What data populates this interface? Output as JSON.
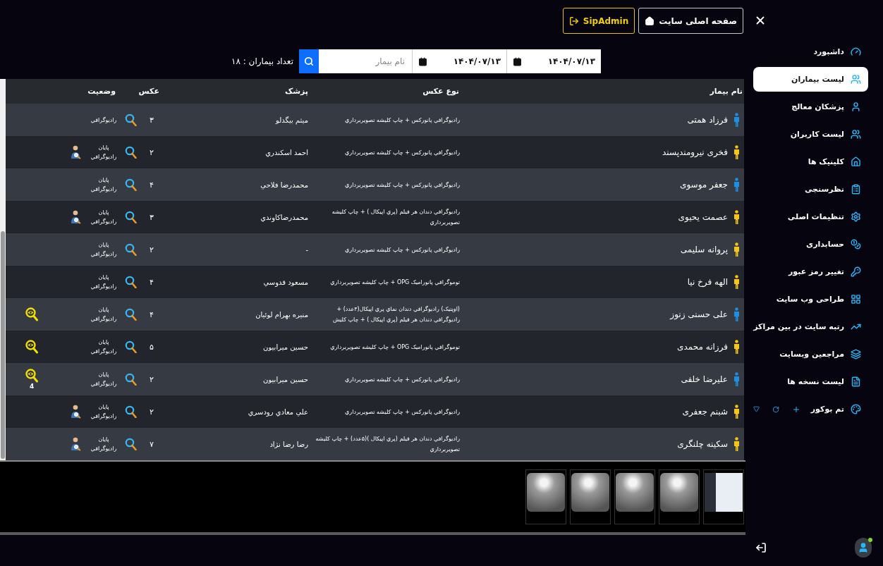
{
  "topbar": {
    "buttons": [
      {
        "label": "صفحه اصلی سایت",
        "kind": "home"
      },
      {
        "label": "SipAdmin",
        "kind": "admin"
      }
    ]
  },
  "filters": {
    "date_from": "۱۴۰۴/۰۷/۱۳",
    "date_to": "۱۴۰۴/۰۷/۱۳",
    "search": {
      "placeholder": "نام بیمار"
    },
    "count": "تعداد بیماران : ۱۸"
  },
  "table": {
    "columns": [
      "نام بیمار",
      "نوع عکس",
      "پزشک",
      "عکس",
      "وضعیت"
    ],
    "rows": [
      {
        "name": "فرزاد همتی",
        "color": "#1e8fe0",
        "type": "رادیوگرافي پانورکس + چاپ کلیشه تصویربرداري",
        "doctor": "میثم بیگدلو",
        "count": "۳",
        "status": "رادیوگرافي"
      },
      {
        "name": "فخری نیرومندپسند",
        "color": "#f5c518",
        "type": "رادیوگرافي پانورکس + چاپ کلیشه تصویربرداري",
        "doctor": "احمد اسکندري",
        "count": "۲",
        "status": "پایان رادیوگرافي",
        "marker": {
          "kind": "reporter"
        }
      },
      {
        "name": "جعفر موسوی",
        "color": "#1e8fe0",
        "type": "رادیوگرافي پانورکس + چاپ کلیشه تصویربرداري",
        "doctor": "محمدرضا فلاحي",
        "count": "۴",
        "status": "پایان رادیوگرافي"
      },
      {
        "name": "عصمت یحیوی",
        "color": "#f5c518",
        "type": "رادیوگرافي دندان هر فیلم (پري اپیکال ) + چاپ کلیشه تصویربرداري",
        "doctor": "محمدرضاکاوندي",
        "count": "۳",
        "status": "پایان رادیوگرافي",
        "marker": {
          "kind": "reporter"
        }
      },
      {
        "name": "پروانه سلیمی",
        "color": "#f5c518",
        "type": "رادیوگرافي پانورکس + چاپ کلیشه تصویربرداري",
        "doctor": "-",
        "count": "۲",
        "status": "پایان رادیوگرافي"
      },
      {
        "name": "الهه فرخ نیا",
        "color": "#f5c518",
        "type": "توموگرافي پانورامیک OPG + چاپ کلیشه تصویربرداري",
        "doctor": "مسعود قدوسي",
        "count": "۴",
        "status": "پایان رادیوگرافي"
      },
      {
        "name": "علی حسنی زنوز",
        "color": "#1e8fe0",
        "type": "(اوپتیک) رادیوگرافي دندان نماي پري اپیکال(۳عدد) + رادیوگرافي دندان هر فیلم (پري اپیکال ) + چاپ کلیش",
        "doctor": "منیره بهرام لوئیان",
        "count": "۴",
        "status": "پایان رادیوگرافي",
        "marker": {
          "kind": "review"
        }
      },
      {
        "name": "فرزانه محمدی",
        "color": "#f5c518",
        "type": "توموگرافي پانورامیک OPG + چاپ کلیشه تصویربرداري",
        "doctor": "حسین میرابیون",
        "count": "۵",
        "status": "پایان رادیوگرافي",
        "marker": {
          "kind": "review"
        }
      },
      {
        "name": "علیرضا خلفی",
        "color": "#1e8fe0",
        "type": "رادیوگرافي پانورکس + چاپ کلیشه تصویربرداري",
        "doctor": "حسین میرابیون",
        "count": "۲",
        "status": "پایان رادیوگرافي",
        "marker": {
          "kind": "review",
          "count": "4"
        }
      },
      {
        "name": "شبنم جعفری",
        "color": "#f5c518",
        "type": "رادیوگرافي پانورکس + چاپ کلیشه تصویربرداري",
        "doctor": "علي معادي رودسري",
        "count": "۲",
        "status": "پایان رادیوگرافي",
        "marker": {
          "kind": "reporter"
        }
      },
      {
        "name": "سکینه چلنگری",
        "color": "#f5c518",
        "type": "رادیوگرافي دندان هر فیلم (پري اپیکال )(۵عدد) + چاپ کلیشه تصویربرداري",
        "doctor": "رضا رضا نژاد",
        "count": "۷",
        "status": "پایان رادیوگرافي",
        "marker": {
          "kind": "reporter"
        }
      }
    ]
  },
  "thumbnails": [
    {
      "kind": "document"
    },
    {
      "kind": "xray"
    },
    {
      "kind": "xray"
    },
    {
      "kind": "xray"
    },
    {
      "kind": "xray"
    }
  ],
  "sidebar": {
    "items": [
      {
        "label": "داشبورد",
        "selected": false
      },
      {
        "label": "لیست بیماران",
        "selected": true
      },
      {
        "label": "پزشکان معالج",
        "selected": false
      },
      {
        "label": "لیست کاربران",
        "selected": false
      },
      {
        "label": "کلینیک ها",
        "selected": false
      },
      {
        "label": "نظرسنجی",
        "selected": false
      },
      {
        "label": "تنظیمات اصلی",
        "selected": false
      },
      {
        "label": "حسابداری",
        "selected": false
      },
      {
        "label": "تغییر رمز عبور",
        "selected": false
      },
      {
        "label": "طراحی وب سایت",
        "selected": false
      },
      {
        "label": "رتبه سایت در بین مراکز",
        "selected": false
      },
      {
        "label": "مراجعین وبسایت",
        "selected": false
      },
      {
        "label": "لیست نسخه ها",
        "selected": false
      }
    ],
    "theme": {
      "label": "تم بوکور"
    }
  },
  "user": {
    "online": true
  }
}
